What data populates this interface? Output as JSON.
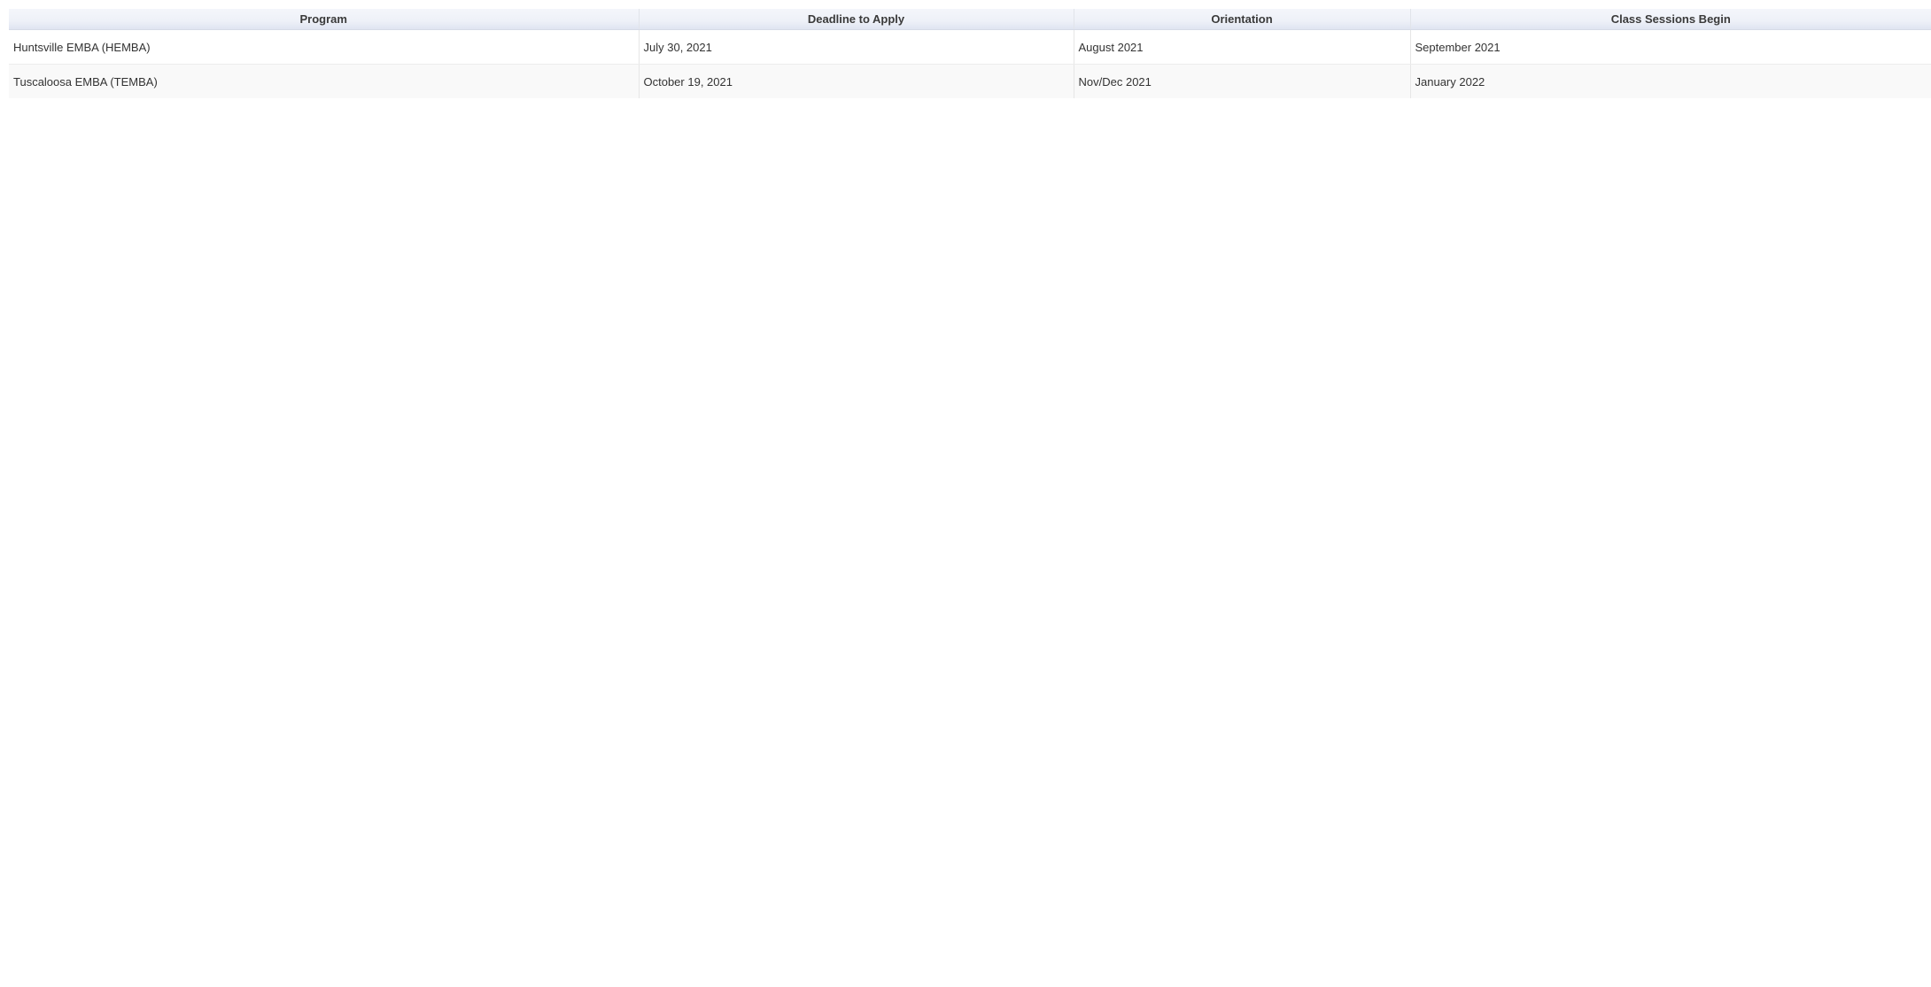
{
  "table": {
    "columns": [
      "Program",
      "Deadline to Apply",
      "Orientation",
      "Class Sessions Begin"
    ],
    "rows": [
      [
        "Huntsville EMBA (HEMBA)",
        "July 30, 2021",
        "August 2021",
        "September 2021"
      ],
      [
        "Tuscaloosa EMBA (TEMBA)",
        "October 19, 2021",
        "Nov/Dec 2021",
        "January 2022"
      ]
    ]
  },
  "colors": {
    "header_bg": "#eef1f8",
    "header_text": "#3a3a3a",
    "row_alt_bg": "#f9f9f9",
    "cell_text": "#333333",
    "border": "#e6e6e6"
  }
}
